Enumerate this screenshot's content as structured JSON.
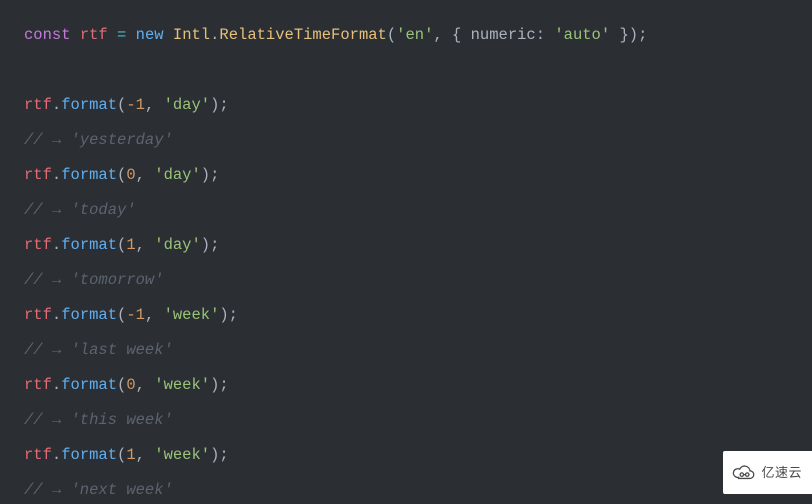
{
  "code": {
    "l1": {
      "kw": "const",
      "var": "rtf",
      "eq": "=",
      "new": "new",
      "ns": "Intl",
      "cls": "RelativeTimeFormat",
      "arg_locale": "'en'",
      "opt_key": "numeric",
      "opt_val": "'auto'"
    },
    "calls": [
      {
        "obj": "rtf",
        "fn": "format",
        "n": "-1",
        "u": "'day'",
        "c": "// → 'yesterday'"
      },
      {
        "obj": "rtf",
        "fn": "format",
        "n": "0",
        "u": "'day'",
        "c": "// → 'today'"
      },
      {
        "obj": "rtf",
        "fn": "format",
        "n": "1",
        "u": "'day'",
        "c": "// → 'tomorrow'"
      },
      {
        "obj": "rtf",
        "fn": "format",
        "n": "-1",
        "u": "'week'",
        "c": "// → 'last week'"
      },
      {
        "obj": "rtf",
        "fn": "format",
        "n": "0",
        "u": "'week'",
        "c": "// → 'this week'"
      },
      {
        "obj": "rtf",
        "fn": "format",
        "n": "1",
        "u": "'week'",
        "c": "// → 'next week'"
      }
    ]
  },
  "punct": {
    "open_p": "(",
    "close_p_semi": ");",
    "comma_sp": ", ",
    "dot": ".",
    "open_brace_sp": "{ ",
    "close_brace": " }",
    "colon_sp": ": "
  },
  "watermark": {
    "text": "亿速云"
  }
}
